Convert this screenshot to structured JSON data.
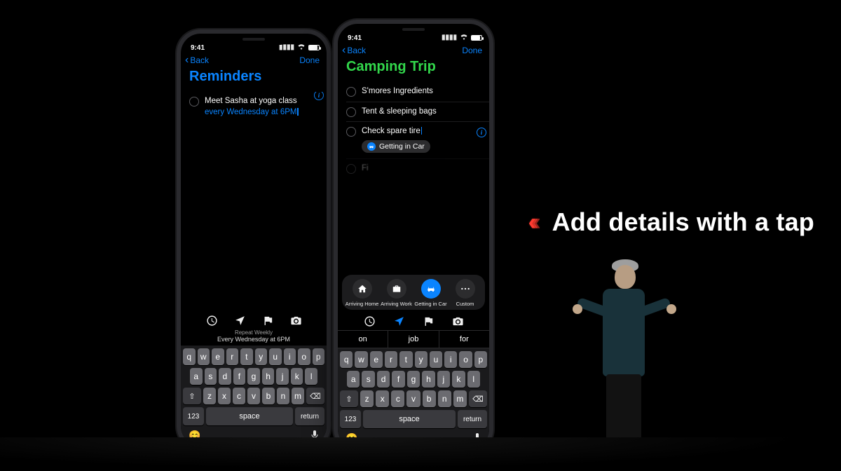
{
  "caption": "Add details with a tap",
  "statusbar": {
    "time": "9:41"
  },
  "nav": {
    "back": "Back",
    "done": "Done"
  },
  "phone1": {
    "title": "Reminders",
    "item_text": "Meet Sasha at yoga class ",
    "item_highlight": "every Wednesday at 6PM",
    "suggest_small": "Repeat Weekly",
    "suggest_main": "Every Wednesday at 6PM"
  },
  "phone2": {
    "title": "Camping Trip",
    "items": [
      "S'mores Ingredients",
      "Tent & sleeping bags",
      "Check spare tire"
    ],
    "chip": "Getting in Car",
    "pills": [
      "Arriving Home",
      "Arriving Work",
      "Getting in Car",
      "Custom"
    ],
    "predict": [
      "on",
      "job",
      "for"
    ]
  },
  "keys": {
    "row1": [
      "q",
      "w",
      "e",
      "r",
      "t",
      "y",
      "u",
      "i",
      "o",
      "p"
    ],
    "row2": [
      "a",
      "s",
      "d",
      "f",
      "g",
      "h",
      "j",
      "k",
      "l"
    ],
    "row3": [
      "z",
      "x",
      "c",
      "v",
      "b",
      "n",
      "m"
    ],
    "num": "123",
    "space": "space",
    "return": "return"
  }
}
